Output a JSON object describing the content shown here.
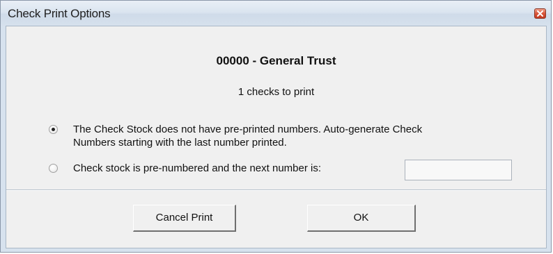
{
  "window": {
    "title": "Check Print Options",
    "close_icon": "close-icon"
  },
  "content": {
    "trust_heading": "00000 - General Trust",
    "checks_count_text": "1 checks to print"
  },
  "options": [
    {
      "label_line1": "The Check Stock does not have pre-printed numbers.  Auto-generate Check",
      "label_line2": "Numbers starting with the last number printed.",
      "selected": true
    },
    {
      "label_line1": "Check stock is pre-numbered and the next number is:",
      "selected": false
    }
  ],
  "next_number_input": {
    "value": "",
    "placeholder": ""
  },
  "buttons": {
    "cancel_label": "Cancel Print",
    "ok_label": "OK"
  },
  "colors": {
    "title_bar": "#dbe5f0",
    "close_button": "#d9553a",
    "dialog_background": "#f0f0f0"
  }
}
